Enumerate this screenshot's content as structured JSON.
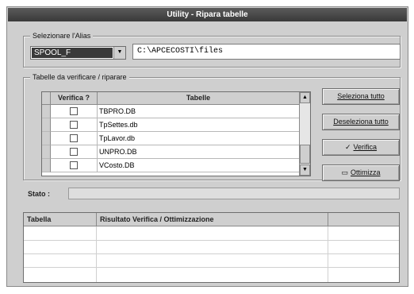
{
  "window": {
    "title": "Utility - Ripara tabelle"
  },
  "folder_group": {
    "label": "Selezionare l'Alias",
    "alias_value": "SPOOL_F",
    "path_value": "C:\\APCECOSTI\\files"
  },
  "tables_group": {
    "label": "Tabelle da verificare / riparare",
    "headers": {
      "check": "Verifica ?",
      "table": "Tabelle"
    },
    "rows": [
      {
        "name": "TBPRO.DB"
      },
      {
        "name": "TpSettes.db"
      },
      {
        "name": "TpLavor.db"
      },
      {
        "name": "UNPRO.DB"
      },
      {
        "name": "VCosto.DB"
      }
    ]
  },
  "buttons": {
    "select_all": "Seleziona tutto",
    "deselect_all": "Deseleziona tutto",
    "verify": "Verifica",
    "optimize": "Ottimizza"
  },
  "icons": {
    "verify": "checkmark-icon",
    "optimize": "window-icon"
  },
  "status": {
    "label": "Stato :",
    "value": ""
  },
  "results": {
    "headers": {
      "table": "Tabella",
      "result": "Risultato Verifica / Ottimizzazione",
      "extra": ""
    }
  }
}
